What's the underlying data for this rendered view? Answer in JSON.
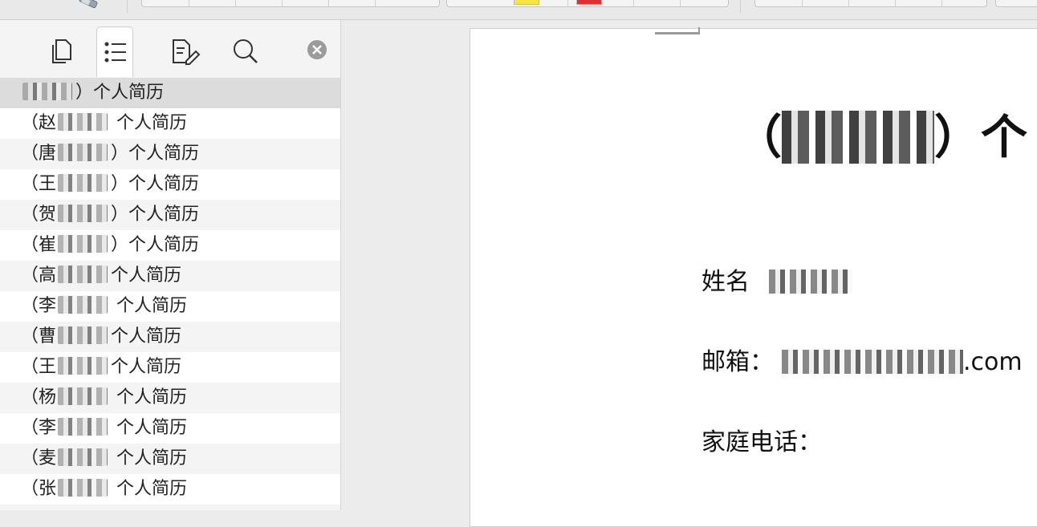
{
  "sidebar": {
    "tabs": [
      {
        "icon": "page-thumbnails-icon"
      },
      {
        "icon": "list-outline-icon"
      },
      {
        "icon": "annotations-icon"
      },
      {
        "icon": "search-icon"
      }
    ],
    "close_icon": "close-circle-icon",
    "items": [
      {
        "prefix": "",
        "suffix": "）个人简历",
        "selected": true
      },
      {
        "prefix": "（赵",
        "suffix": " 个人简历"
      },
      {
        "prefix": "（唐",
        "suffix": "）个人简历"
      },
      {
        "prefix": "（王",
        "suffix": "）个人简历"
      },
      {
        "prefix": "（贺",
        "suffix": "）个人简历"
      },
      {
        "prefix": "（崔",
        "suffix": "）个人简历"
      },
      {
        "prefix": "（高",
        "suffix": "个人简历"
      },
      {
        "prefix": "（李",
        "suffix": " 个人简历"
      },
      {
        "prefix": "（曹",
        "suffix": "个人简历"
      },
      {
        "prefix": "（王",
        "suffix": "个人简历"
      },
      {
        "prefix": "（杨",
        "suffix": " 个人简历"
      },
      {
        "prefix": "（李",
        "suffix": " 个人简历"
      },
      {
        "prefix": "（麦",
        "suffix": " 个人简历"
      },
      {
        "prefix": "（张",
        "suffix": " 个人简历"
      }
    ]
  },
  "document": {
    "title_prefix": "（",
    "title_suffix": "）个",
    "name_label": "姓名",
    "email_label": "邮箱：",
    "email_suffix": ".com",
    "home_phone_label": "家庭电话："
  },
  "colors": {
    "swatch_yellow": "#f5e642",
    "swatch_red": "#e03030"
  }
}
